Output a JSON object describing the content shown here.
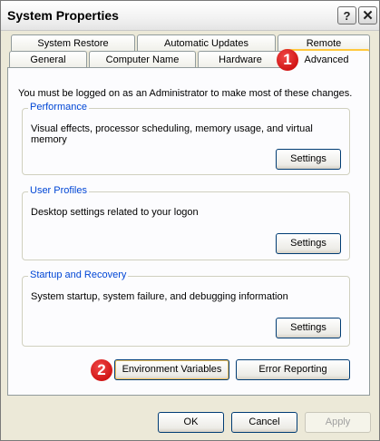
{
  "window": {
    "title": "System Properties",
    "help": "?",
    "close": "✕"
  },
  "tabs_back": [
    "System Restore",
    "Automatic Updates",
    "Remote"
  ],
  "tabs_front": [
    "General",
    "Computer Name",
    "Hardware",
    "Advanced"
  ],
  "note": "You must be logged on as an Administrator to make most of these changes.",
  "groups": {
    "performance": {
      "title": "Performance",
      "desc": "Visual effects, processor scheduling, memory usage, and virtual memory",
      "button": "Settings"
    },
    "profiles": {
      "title": "User Profiles",
      "desc": "Desktop settings related to your logon",
      "button": "Settings"
    },
    "startup": {
      "title": "Startup and Recovery",
      "desc": "System startup, system failure, and debugging information",
      "button": "Settings"
    }
  },
  "actions": {
    "env": "Environment Variables",
    "errors": "Error Reporting"
  },
  "footer": {
    "ok": "OK",
    "cancel": "Cancel",
    "apply": "Apply"
  },
  "markers": {
    "one": "1",
    "two": "2"
  }
}
